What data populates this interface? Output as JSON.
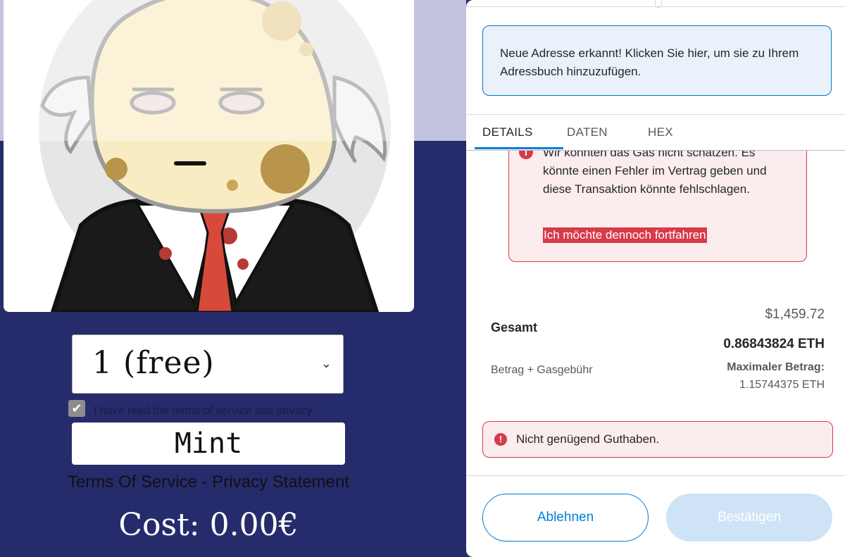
{
  "mint_page": {
    "quantity": {
      "selected": "1 (free)"
    },
    "terms_checkbox": {
      "checked": true,
      "label": "I have read the terms of service and privacy"
    },
    "mint_button": "Mint",
    "links": "Terms Of Service - Privacy Statement",
    "cost": "Cost: 0.00€"
  },
  "wallet_panel": {
    "address_notice": "Neue Adresse erkannt! Klicken Sie hier, um sie zu Ihrem Adressbuch hinzuzufügen.",
    "tabs": [
      {
        "label": "DETAILS",
        "active": true
      },
      {
        "label": "DATEN",
        "active": false
      },
      {
        "label": "HEX",
        "active": false
      }
    ],
    "gas_warning": {
      "text": "Wir konnten das Gas nicht schätzen. Es könnte einen Fehler im Vertrag geben und diese Transaktion könnte fehlschlagen.",
      "link": "Ich möchte dennoch fortfahren"
    },
    "total": {
      "label": "Gesamt",
      "fiat": "$1,459.72",
      "eth": "0.86843824 ETH",
      "sub_label": "Betrag + Gasgebühr",
      "max_label": "Maximaler Betrag:",
      "max_value": "1.15744375 ETH"
    },
    "funds_error": "Nicht genügend Guthaben.",
    "buttons": {
      "reject": "Ablehnen",
      "confirm": "Bestätigen"
    }
  },
  "colors": {
    "page_navy": "#262b6b",
    "metamask_blue": "#037dd6",
    "error_red": "#d73a49",
    "error_bg": "#fbeced",
    "notice_bg": "#eaf1fb"
  },
  "icons": [
    "chevron-down-icon",
    "checkmark-icon",
    "info-error-icon",
    "alert-circle-icon"
  ]
}
